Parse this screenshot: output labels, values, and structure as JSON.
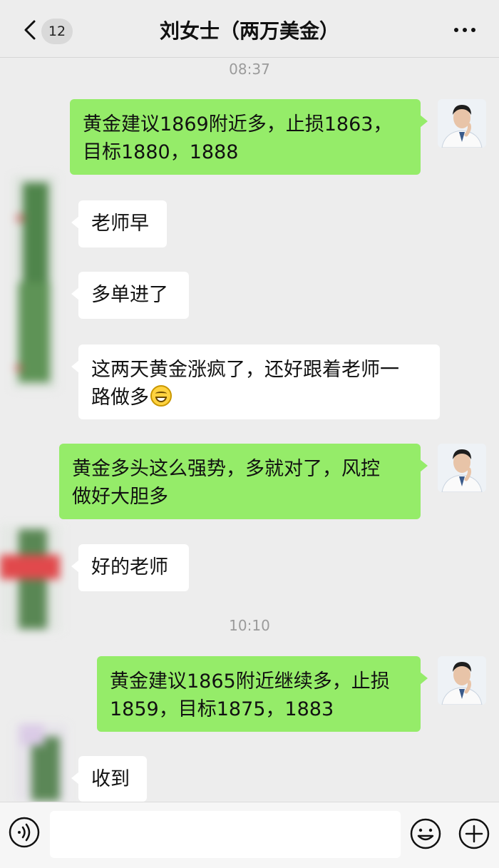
{
  "header": {
    "back_count": "12",
    "title": "刘女士（两万美金）"
  },
  "timestamps": [
    "08:37",
    "10:10"
  ],
  "messages": [
    {
      "from": "teacher",
      "text": "黄金建议1869附近多，止损1863，\n目标1880，1888"
    },
    {
      "from": "client",
      "text": "老师早"
    },
    {
      "from": "client",
      "text": "多单进了"
    },
    {
      "from": "client",
      "text": "这两天黄金涨疯了，还好跟着老师一\n路做多"
    },
    {
      "from": "teacher",
      "text": "黄金多头这么强势，多就对了，风控\n做好大胆多"
    },
    {
      "from": "client",
      "text": "好的老师"
    },
    {
      "from": "teacher",
      "text": "黄金建议1865附近继续多，止损\n1859，目标1875，1883"
    },
    {
      "from": "client",
      "text": "收到"
    }
  ],
  "icons": {
    "back": "chevron-left-icon",
    "more": "more-dots-icon",
    "voice": "voice-icon",
    "emoji": "emoji-icon",
    "plus": "plus-icon"
  },
  "colors": {
    "outgoing_bubble": "#95ec69",
    "incoming_bubble": "#ffffff",
    "background": "#ededed"
  }
}
